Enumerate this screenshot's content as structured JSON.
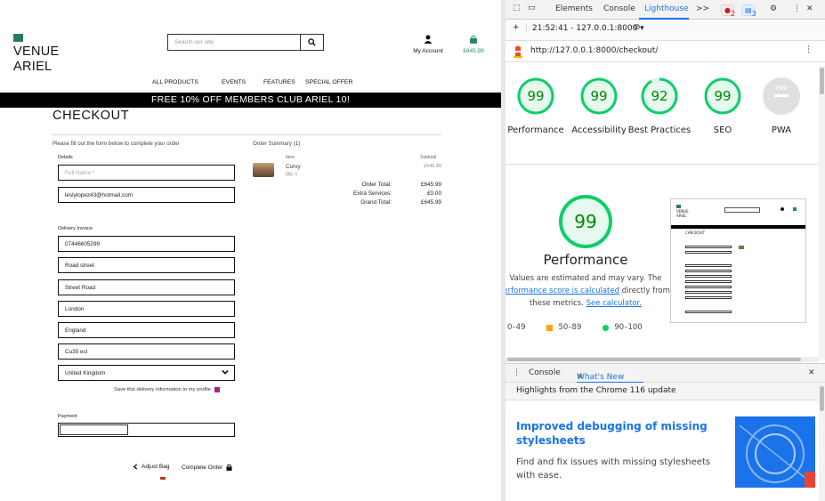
{
  "site": {
    "logo": {
      "line1": "VENUE",
      "line2": "ARIEL"
    },
    "search": {
      "placeholder": "Search our site"
    },
    "account_label": "My Account",
    "bag_total": "£645.99",
    "nav": [
      "ALL PRODUCTS",
      "EVENTS",
      "FEATURES",
      "SPECIAL OFFER"
    ],
    "banner": "FREE 10% OFF MEMBERS CLUB ARIEL 10!",
    "page_title": "CHECKOUT",
    "intro": "Please fill out the form below to complete your order",
    "details_label": "Details",
    "full_name_placeholder": "Full Name *",
    "email": "leslylopez43@hotmail.com",
    "delivery_label": "Delivery Invoice",
    "phone": "07446605299",
    "street1": "Road street",
    "street2": "Street Road",
    "town": "London",
    "county": "England",
    "postcode": "Cu35 ecl",
    "country": "United Kingdom",
    "save_info": "Save this delivery information to my profile",
    "payment_label": "Payment",
    "adjust_bag": "Adjust Bag",
    "complete_order": "Complete Order",
    "summary": {
      "title": "Order Summary (1)",
      "col_item": "Item",
      "col_subtotal": "Subtotal",
      "item_name": "Curvy",
      "item_qty": "Qty: 1",
      "item_subtotal": "£645.99",
      "order_total_label": "Order Total:",
      "order_total": "£645.99",
      "extra_label": "Extra Services:",
      "extra": "£0.00",
      "grand_label": "Grand Total:",
      "grand": "£645.99"
    }
  },
  "devtools": {
    "tabs": [
      "Elements",
      "Console",
      "Lighthouse"
    ],
    "active_tab": "Lighthouse",
    "more": ">>",
    "errors": "2",
    "messages": "3",
    "report_time": "21:52:41 - 127.0.0.1:8000",
    "url": "http://127.0.0.1:8000/checkout/",
    "scores": [
      {
        "label": "Performance",
        "value": "99"
      },
      {
        "label": "Accessibility",
        "value": "99"
      },
      {
        "label": "Best Practices",
        "value": "92"
      },
      {
        "label": "SEO",
        "value": "99"
      },
      {
        "label": "PWA",
        "value": "PWA"
      }
    ],
    "perf_score": "99",
    "perf_title": "Performance",
    "perf_text1": "Values are estimated and may vary. The",
    "perf_link": "performance score is calculated",
    "perf_text2": "directly from",
    "perf_text3": "these metrics.",
    "calc_link": "See calculator.",
    "legend": [
      "0–49",
      "50–89",
      "90–100"
    ],
    "drawer_tabs": [
      "Console",
      "What's New"
    ],
    "drawer_sub": "Highlights from the Chrome 116 update",
    "wn_title": "Improved debugging of missing stylesheets",
    "wn_text": "Find and fix issues with missing stylesheets with ease.",
    "colors": {
      "pass": "#0cce6b",
      "pass_text": "#008800",
      "average": "#ffa400",
      "fail": "#ff4e42",
      "accent": "#1a73e8",
      "brand": "#2b7a5f"
    }
  }
}
